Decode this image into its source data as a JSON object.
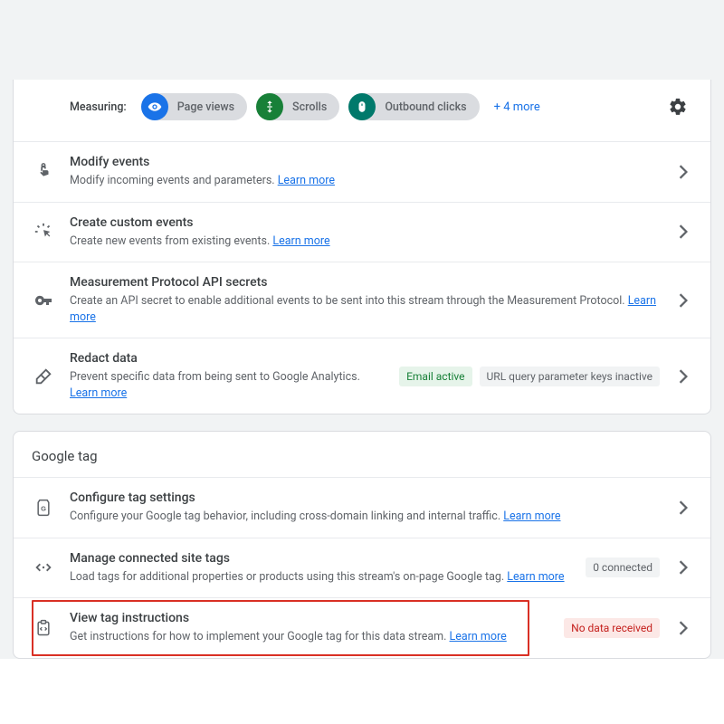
{
  "measuring": {
    "label": "Measuring:",
    "chips": [
      {
        "label": "Page views"
      },
      {
        "label": "Scrolls"
      },
      {
        "label": "Outbound clicks"
      }
    ],
    "more": "+ 4 more"
  },
  "events_rows": [
    {
      "title": "Modify events",
      "desc": "Modify incoming events and parameters.",
      "learn_more": "Learn more"
    },
    {
      "title": "Create custom events",
      "desc": "Create new events from existing events.",
      "learn_more": "Learn more"
    },
    {
      "title": "Measurement Protocol API secrets",
      "desc": "Create an API secret to enable additional events to be sent into this stream through the Measurement Protocol.",
      "learn_more": "Learn more"
    },
    {
      "title": "Redact data",
      "desc": "Prevent specific data from being sent to Google Analytics.",
      "learn_more": "Learn more",
      "badges": [
        {
          "text": "Email active",
          "cls": "badge-green"
        },
        {
          "text": "URL query parameter keys inactive",
          "cls": "badge-gray"
        }
      ]
    }
  ],
  "google_tag": {
    "heading": "Google tag",
    "rows": [
      {
        "title": "Configure tag settings",
        "desc": "Configure your Google tag behavior, including cross-domain linking and internal traffic.",
        "learn_more": "Learn more"
      },
      {
        "title": "Manage connected site tags",
        "desc": "Load tags for additional properties or products using this stream's on-page Google tag.",
        "learn_more": "Learn more",
        "badges": [
          {
            "text": "0 connected",
            "cls": "badge-gray"
          }
        ]
      },
      {
        "title": "View tag instructions",
        "desc": "Get instructions for how to implement your Google tag for this data stream.",
        "learn_more": "Learn more",
        "badges": [
          {
            "text": "No data received",
            "cls": "badge-red"
          }
        ]
      }
    ]
  }
}
